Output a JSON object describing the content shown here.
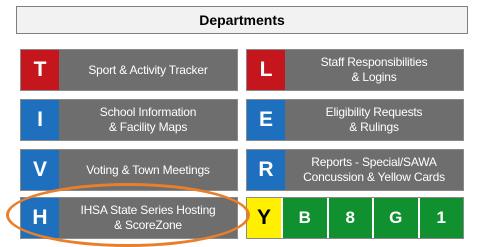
{
  "header": {
    "title": "Departments"
  },
  "tiles": [
    {
      "letter": "T",
      "label": "Sport & Activity Tracker"
    },
    {
      "letter": "L",
      "label": "Staff Responsibilities\n& Logins"
    },
    {
      "letter": "I",
      "label": "School Information\n& Facility Maps"
    },
    {
      "letter": "E",
      "label": "Eligibility Requests\n& Rulings"
    },
    {
      "letter": "V",
      "label": "Voting & Town Meetings"
    },
    {
      "letter": "R",
      "label": "Reports - Special/SAWA\nConcussion & Yellow Cards"
    },
    {
      "letter": "H",
      "label": "IHSA State Series Hosting\n& ScoreZone"
    }
  ],
  "grades": {
    "letter": "Y",
    "cells": [
      "B",
      "8",
      "G",
      "1"
    ]
  },
  "colors": {
    "red": "#c5161e",
    "blue": "#1f6fbf",
    "yellow": "#ffef00",
    "green": "#10902f",
    "tile_gray": "#6e6e6e",
    "highlight_orange": "#e87f2c"
  }
}
